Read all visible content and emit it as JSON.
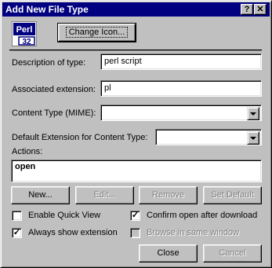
{
  "window": {
    "title": "Add New File Type",
    "help_glyph": "?",
    "close_glyph": "✕"
  },
  "icon": {
    "name": "perl-icon",
    "text_top": "Perl",
    "text_bottom": "32"
  },
  "buttons": {
    "change_icon": "Change Icon...",
    "new": "New...",
    "edit": "Edit...",
    "remove": "Remove",
    "set_default": "Set Default",
    "close": "Close",
    "cancel": "Cancel"
  },
  "fields": {
    "description_label": "Description of type:",
    "description_value": "perl script",
    "extension_label": "Associated extension:",
    "extension_value": "pl",
    "content_type_label": "Content Type (MIME):",
    "content_type_value": "",
    "default_ext_label": "Default Extension for Content Type:",
    "default_ext_value": "",
    "actions_label": "Actions:"
  },
  "actions": [
    "open"
  ],
  "checkboxes": {
    "quick_view": {
      "label": "Enable Quick View",
      "checked": false,
      "enabled": true
    },
    "confirm_open": {
      "label": "Confirm open after download",
      "checked": true,
      "enabled": true
    },
    "always_show_ext": {
      "label": "Always show extension",
      "checked": true,
      "enabled": true
    },
    "browse_same_window": {
      "label": "Browse in same window",
      "checked": false,
      "enabled": false
    }
  },
  "colors": {
    "titlebar": "#000080",
    "face": "#c0c0c0",
    "disabled_text": "#808080"
  }
}
